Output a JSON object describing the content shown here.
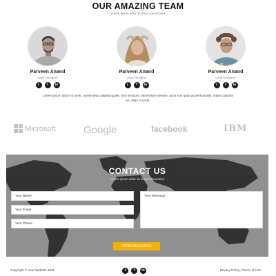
{
  "team": {
    "title": "OUR AMAZING TEAM",
    "subtitle": "Lorem ipsum dolor sit amet consectetur",
    "members": [
      {
        "name": "Parveen Anand",
        "role": "Lead Designer"
      },
      {
        "name": "Parveen Anand",
        "role": "Lead Designer"
      },
      {
        "name": "Parveen Anand",
        "role": "Lead Designer"
      }
    ],
    "socials": [
      "twitter-icon",
      "facebook-icon",
      "linkedin-icon"
    ],
    "paragraph": "Lorem ipsum dolor sit amet, consectetur adipiscing elit. Sed tincidunt, laboriosam veniam, quos non quas ad perspiciatis, totam corporis ea, alias ut unde."
  },
  "logos": {
    "microsoft": "Microsoft",
    "google": "Google",
    "facebook": "facebook",
    "ibm": "IBM"
  },
  "contact": {
    "title": "CONTACT US",
    "subtitle": "Lorem ipsum dolor sit amet consectetur",
    "name_placeholder": "Your Name",
    "email_placeholder": "Your Email",
    "phone_placeholder": "Your Phone",
    "message_placeholder": "Your Message",
    "send_label": "SEND MESSAGE"
  },
  "footer": {
    "copyright": "Copyright © Your Website 2021",
    "legal": "Privacy Policy | Terms of Use"
  },
  "colors": {
    "accent": "#f5b000",
    "social_bg": "#1a1a1a",
    "contact_bg": "#8f8f8f"
  }
}
